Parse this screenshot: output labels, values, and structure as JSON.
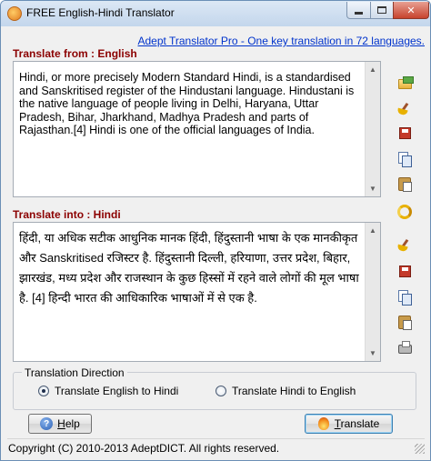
{
  "window": {
    "title": "FREE English-Hindi Translator"
  },
  "promo_link": "Adept Translator Pro - One key translation in 72 languages.",
  "source": {
    "label": "Translate from : English",
    "text": "Hindi, or more precisely Modern Standard Hindi, is a standardised and Sanskritised register of the Hindustani language. Hindustani is the native language of people living in Delhi, Haryana, Uttar Pradesh, Bihar, Jharkhand, Madhya Pradesh and parts of Rajasthan.[4] Hindi is one of the official languages of India."
  },
  "target": {
    "label": "Translate into : Hindi",
    "text": "हिंदी, या अधिक सटीक आधुनिक मानक हिंदी, हिंदुस्तानी भाषा के एक मानकीकृत और Sanskritised रजिस्टर है. हिंदुस्तानी दिल्ली, हरियाणा, उत्तर प्रदेश, बिहार, झारखंड, मध्य प्रदेश और राजस्थान के कुछ हिस्सों में रहने वाले लोगों की मूल भाषा है. [4] हिन्दी भारत की आधिकारिक भाषाओं में से एक है."
  },
  "toolbar_icons": {
    "source": [
      "open-folder-icon",
      "clear-broom-icon",
      "save-icon",
      "copy-icon",
      "paste-icon"
    ],
    "swap": "swap-icon",
    "target": [
      "clear-broom-icon",
      "save-icon",
      "copy-icon",
      "paste-icon",
      "print-icon"
    ]
  },
  "direction": {
    "title": "Translation Direction",
    "options": [
      {
        "label": "Translate English to Hindi",
        "selected": true
      },
      {
        "label": "Translate Hindi to English",
        "selected": false
      }
    ]
  },
  "buttons": {
    "help": "Help",
    "translate": "Translate"
  },
  "status": {
    "copyright": "Copyright (C) 2010-2013 AdeptDICT. All rights reserved."
  },
  "colors": {
    "section_label": "#8b0000",
    "link": "#0033cc"
  }
}
